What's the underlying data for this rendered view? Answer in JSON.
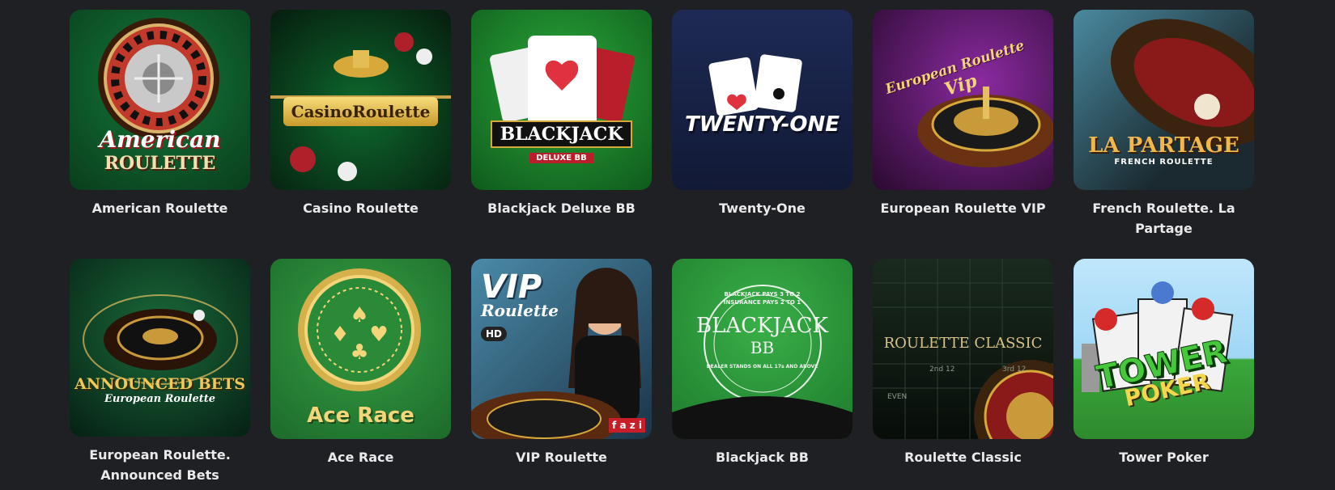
{
  "games": [
    {
      "title": "American Roulette",
      "art_text": [
        "American",
        "ROULETTE"
      ],
      "icon": "roulette-wheel-icon",
      "colors": [
        "#0c5a2a",
        "#0a3d1c"
      ]
    },
    {
      "title": "Casino Roulette",
      "art_text": [
        "CasinoRoulette"
      ],
      "icon": "golden-roulette-icon",
      "colors": [
        "#0b4d22",
        "#061c0e"
      ]
    },
    {
      "title": "Blackjack Deluxe BB",
      "art_text": [
        "BLACKJACK",
        "DELUXE BB"
      ],
      "icon": "playing-cards-icon",
      "colors": [
        "#1e8a2e",
        "#0f5a1c"
      ]
    },
    {
      "title": "Twenty-One",
      "art_text": [
        "TWENTY-ONE"
      ],
      "icon": "playing-cards-icon",
      "colors": [
        "#1e2a55",
        "#111935"
      ]
    },
    {
      "title": "European Roulette VIP",
      "art_text": [
        "European Roulette",
        "Vip"
      ],
      "icon": "roulette-wheel-icon",
      "colors": [
        "#6a1d7a",
        "#2a0a2f"
      ]
    },
    {
      "title": "French Roulette. La Partage",
      "art_text": [
        "LA PARTAGE",
        "FRENCH ROULETTE"
      ],
      "icon": "roulette-wheel-icon",
      "colors": [
        "#3a6a7a",
        "#1a2a30"
      ]
    },
    {
      "title": "European Roulette. Announced Bets",
      "art_text": [
        "ANNOUNCED BETS",
        "European Roulette"
      ],
      "icon": "roulette-wheel-icon",
      "colors": [
        "#0f4a2a",
        "#062014"
      ]
    },
    {
      "title": "Ace Race",
      "art_text": [
        "Ace Race"
      ],
      "icon": "card-suits-coin-icon",
      "colors": [
        "#2f8a3c",
        "#1c6a2a"
      ]
    },
    {
      "title": "VIP Roulette",
      "art_text": [
        "VIP",
        "Roulette",
        "HD",
        "f a z i"
      ],
      "icon": "dealer-roulette-icon",
      "colors": [
        "#3d6e8a",
        "#1c3448"
      ]
    },
    {
      "title": "Blackjack BB",
      "art_text": [
        "BLACKJACK",
        "BB",
        "BLACKJACK PAYS 3 TO 2",
        "INSURANCE PAYS 2 TO 1",
        "DEALER STANDS ON ALL 17s AND ABOVE"
      ],
      "icon": "blackjack-table-icon",
      "colors": [
        "#2e9a3e",
        "#1e7a2c"
      ]
    },
    {
      "title": "Roulette Classic",
      "art_text": [
        "ROULETTE CLASSIC",
        "2nd 12",
        "3rd 12",
        "EVEN"
      ],
      "icon": "roulette-table-icon",
      "colors": [
        "#122016",
        "#070d09"
      ]
    },
    {
      "title": "Tower Poker",
      "art_text": [
        "TOWER",
        "POKER"
      ],
      "icon": "tower-poker-characters-icon",
      "colors": [
        "#9fd7f5",
        "#3aa83a"
      ]
    }
  ]
}
